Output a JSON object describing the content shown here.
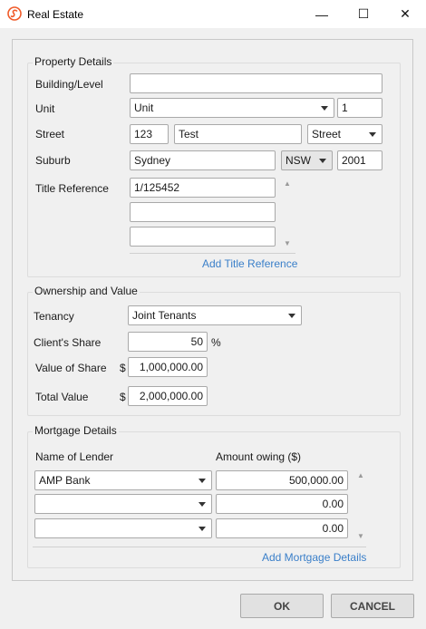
{
  "window": {
    "title": "Real Estate",
    "icon": "app-logo-icon",
    "controls": {
      "minimize": "—",
      "maximize": "☐",
      "close": "✕"
    }
  },
  "property_details": {
    "title": "Property Details",
    "building_level": {
      "label": "Building/Level",
      "value": ""
    },
    "unit": {
      "label": "Unit",
      "type_value": "Unit",
      "number_value": "1"
    },
    "street": {
      "label": "Street",
      "number_value": "123",
      "name_value": "Test",
      "type_value": "Street"
    },
    "suburb": {
      "label": "Suburb",
      "value": "Sydney",
      "state_value": "NSW",
      "postcode_value": "2001"
    },
    "title_reference": {
      "label": "Title Reference",
      "values": [
        "1/125452",
        "",
        ""
      ]
    },
    "add_link": "Add Title Reference"
  },
  "ownership": {
    "title": "Ownership and Value",
    "tenancy": {
      "label": "Tenancy",
      "value": "Joint Tenants"
    },
    "client_share": {
      "label": "Client's Share",
      "value": "50",
      "unit": "%"
    },
    "value_of_share": {
      "label": "Value of Share",
      "currency": "$",
      "value": "1,000,000.00"
    },
    "total_value": {
      "label": "Total Value",
      "currency": "$",
      "value": "2,000,000.00"
    }
  },
  "mortgage": {
    "title": "Mortgage Details",
    "col_lender": "Name of Lender",
    "col_amount": "Amount owing ($)",
    "rows": [
      {
        "lender": "AMP Bank",
        "amount": "500,000.00"
      },
      {
        "lender": "",
        "amount": "0.00"
      },
      {
        "lender": "",
        "amount": "0.00"
      }
    ],
    "add_link": "Add Mortgage Details"
  },
  "footer": {
    "ok_label": "OK",
    "cancel_label": "CANCEL"
  },
  "colors": {
    "accent": "#f05a28",
    "link": "#3a7fc9"
  }
}
